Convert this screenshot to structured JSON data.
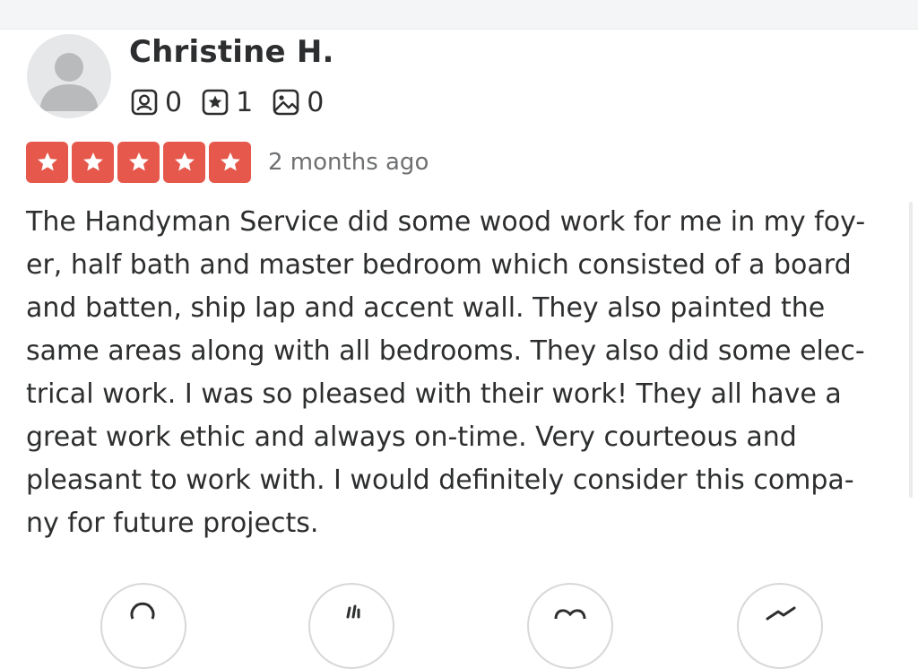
{
  "reviewer": {
    "name": "Christine H.",
    "avatar_icon": "default-user-avatar-icon",
    "stats": [
      {
        "icon": "friends-icon",
        "value": "0"
      },
      {
        "icon": "reviews-icon",
        "value": "1"
      },
      {
        "icon": "photos-icon",
        "value": "0"
      }
    ]
  },
  "rating": {
    "stars": 5,
    "max_stars": 5,
    "star_color": "#e7584c",
    "date": "2 months ago"
  },
  "review": {
    "lines": [
      "The Handyman Service did some wood work for me in my foy-",
      "er, half bath and master bedroom which consisted of a board",
      "and batten, ship lap and accent wall. They also painted the",
      "same areas along with all bedrooms. They also did some elec-",
      "trical work. I was so pleased with their work! They all have a",
      "great work ethic and always on-time. Very courteous and",
      "pleasant to work with. I would definitely consider this compa-",
      "ny for future projects."
    ]
  },
  "actions": [
    {
      "icon": "helpful-icon"
    },
    {
      "icon": "thanks-icon"
    },
    {
      "icon": "love-icon"
    },
    {
      "icon": "oh-no-icon"
    }
  ]
}
